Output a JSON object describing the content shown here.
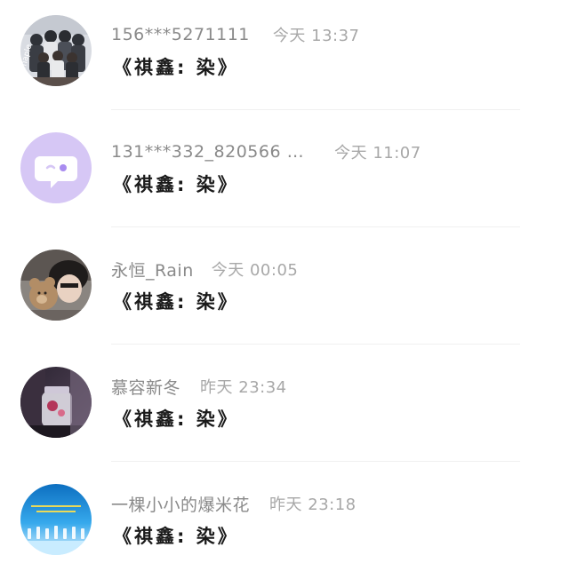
{
  "comments": [
    {
      "username": "156***5271111",
      "time": "今天 13:37",
      "text": "《祺鑫: 染》",
      "avatar_icon": "group-photo-avatar",
      "avatar_colors": [
        "#3a3d44",
        "#d9dce2"
      ]
    },
    {
      "username": "131***332_820566 …",
      "time": "今天 11:07",
      "text": "《祺鑫: 染》",
      "avatar_icon": "default-chat-bubble-avatar",
      "avatar_colors": [
        "#d6c7f5",
        "#ffffff"
      ]
    },
    {
      "username": "永恒_Rain",
      "time": "今天 00:05",
      "text": "《祺鑫: 染》",
      "avatar_icon": "boy-with-teddy-bear-avatar",
      "avatar_colors": [
        "#6b5d55",
        "#c9a37c"
      ]
    },
    {
      "username": "慕容新冬",
      "time": "昨天 23:34",
      "text": "《祺鑫: 染》",
      "avatar_icon": "glass-jar-photo-avatar",
      "avatar_colors": [
        "#4a3a4e",
        "#e8dde8"
      ]
    },
    {
      "username": "一棵小小的爆米花",
      "time": "昨天 23:18",
      "text": "《祺鑫: 染》",
      "avatar_icon": "stage-performance-avatar",
      "avatar_colors": [
        "#1a8fd6",
        "#e8f6ff"
      ]
    }
  ]
}
